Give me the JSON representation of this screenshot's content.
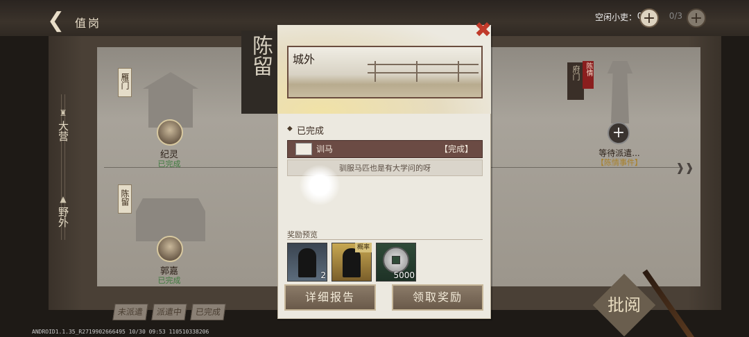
{
  "header": {
    "title": "值岗",
    "idle_label": "空闲小吏：",
    "idle_count": "0/3",
    "idle_count_2": "0/3"
  },
  "sidebar": {
    "tab1": "大营",
    "tab2": "野外"
  },
  "cities": [
    {
      "tag": "雁门",
      "general": "纪灵",
      "status": "已完成"
    },
    {
      "tag": "陈留",
      "general": "郭嘉",
      "status": "已完成"
    }
  ],
  "right_city": {
    "tag": "府门",
    "tag2": "陈情",
    "waiting": "等待派遣...",
    "event": "【陈情事件】"
  },
  "filters": [
    "未派遣",
    "派遣中",
    "已完成"
  ],
  "version": "ANDROID1.1.35_R2719902666495 10/30 09:53 110510338206",
  "approve_seal": "批阅",
  "modal": {
    "city": "陈留",
    "scene_title": "城外",
    "section_done": "已完成",
    "task_name": "训马",
    "task_status": "【完成】",
    "task_desc": "驯服马匹也是有大学问的呀",
    "reward_header": "奖励预览",
    "rewards": [
      {
        "name": "silhouette-card",
        "count": "2"
      },
      {
        "name": "gold-silhouette-card",
        "count": "",
        "tag": "概率"
      },
      {
        "name": "copper-coin",
        "count": "5000"
      }
    ],
    "btn_report": "详细报告",
    "btn_claim": "领取奖励"
  }
}
